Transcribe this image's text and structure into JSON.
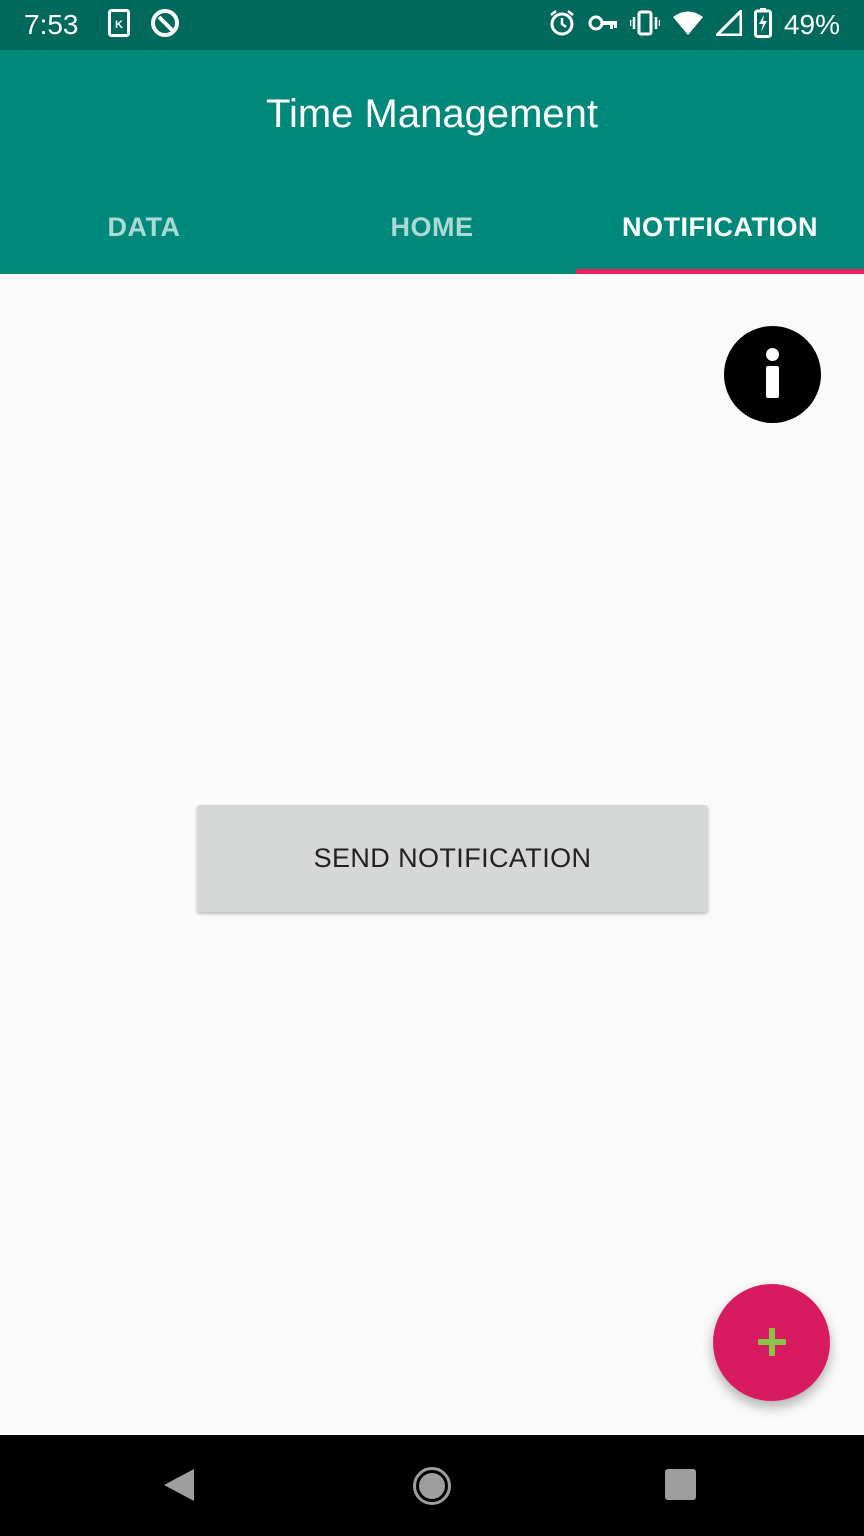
{
  "status_bar": {
    "time": "7:53",
    "battery_percent": "49%",
    "left_icons": [
      "k-app-icon",
      "q-app-icon"
    ],
    "right_icons": [
      "alarm-icon",
      "vpn-key-icon",
      "vibrate-icon",
      "wifi-icon",
      "cell-signal-icon",
      "battery-charging-icon"
    ]
  },
  "app_bar": {
    "title": "Time Management",
    "color": "#00897b"
  },
  "tabs": [
    {
      "label": "DATA",
      "selected": false
    },
    {
      "label": "HOME",
      "selected": false
    },
    {
      "label": "NOTIFICATION",
      "selected": true
    }
  ],
  "tab_indicator_color": "#e91e63",
  "main": {
    "info_icon": "info-icon",
    "send_button_label": "SEND NOTIFICATION"
  },
  "fab": {
    "icon": "plus-icon",
    "color": "#d81b60",
    "icon_color": "#8bc34a"
  },
  "nav_bar": {
    "buttons": [
      "back-icon",
      "home-icon",
      "recents-icon"
    ]
  }
}
